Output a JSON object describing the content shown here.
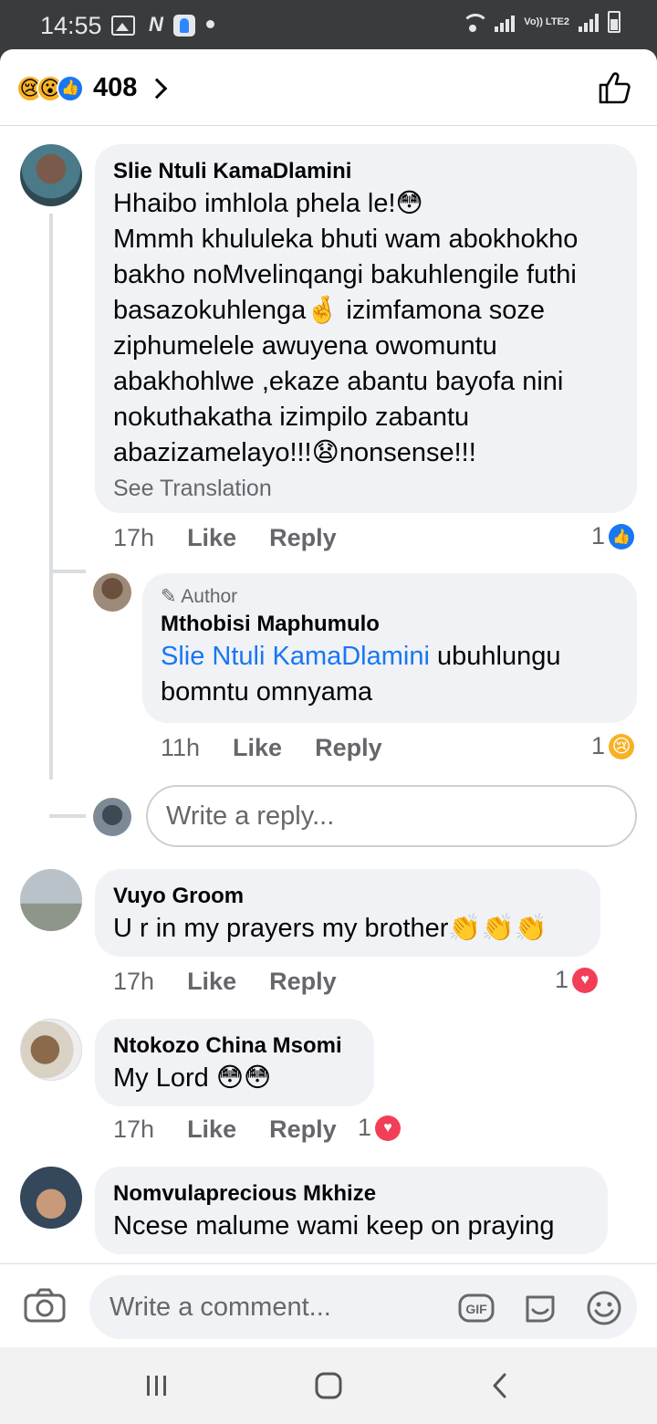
{
  "status_bar": {
    "time": "14:55",
    "network_label": "Vo)) LTE2"
  },
  "header": {
    "reaction_count": "408",
    "reactions": [
      "sad",
      "wow",
      "like"
    ]
  },
  "comments": [
    {
      "author": "Slie Ntuli KamaDlamini",
      "text_lines": [
        "Hhaibo imhlola phela le!😳",
        "Mmmh khululeka bhuti wam abokhokho",
        "bakho noMvelinqangi bakuhlengile futhi",
        "basazokuhlenga🤞 izimfamona soze",
        "ziphumelele awuyena owomuntu",
        "abakhohlwe ,ekaze abantu bayofa nini",
        "nokuthakatha izimpilo zabantu",
        "abazizamelayo!!!😧nonsense!!!"
      ],
      "see_translation": "See Translation",
      "time": "17h",
      "like": "Like",
      "reply": "Reply",
      "reaction_count": "1",
      "reaction": "like"
    },
    {
      "author_tag": "Author",
      "author": "Mthobisi Maphumulo",
      "mention": "Slie Ntuli KamaDlamini",
      "text_after_mention": "ubuhlungu",
      "text_line2": "bomntu omnyama",
      "time": "11h",
      "like": "Like",
      "reply": "Reply",
      "reaction_count": "1",
      "reaction": "sad"
    },
    {
      "author": "Vuyo Groom",
      "text": "U r in my prayers my brother👏👏👏",
      "time": "17h",
      "like": "Like",
      "reply": "Reply",
      "reaction_count": "1",
      "reaction": "love"
    },
    {
      "author": "Ntokozo China Msomi",
      "text": "My Lord 😳😳",
      "time": "17h",
      "like": "Like",
      "reply": "Reply",
      "reaction_count": "1",
      "reaction": "love"
    },
    {
      "author": "Nomvulaprecious Mkhize",
      "text": "Ncese malume wami keep on praying"
    }
  ],
  "reply_input": {
    "placeholder": "Write a reply..."
  },
  "composer": {
    "placeholder": "Write a comment...",
    "gif_label": "GIF"
  },
  "colors": {
    "accent": "#1877f2",
    "love": "#f33e58",
    "bubble": "#f0f2f5",
    "muted_text": "#65676b"
  }
}
